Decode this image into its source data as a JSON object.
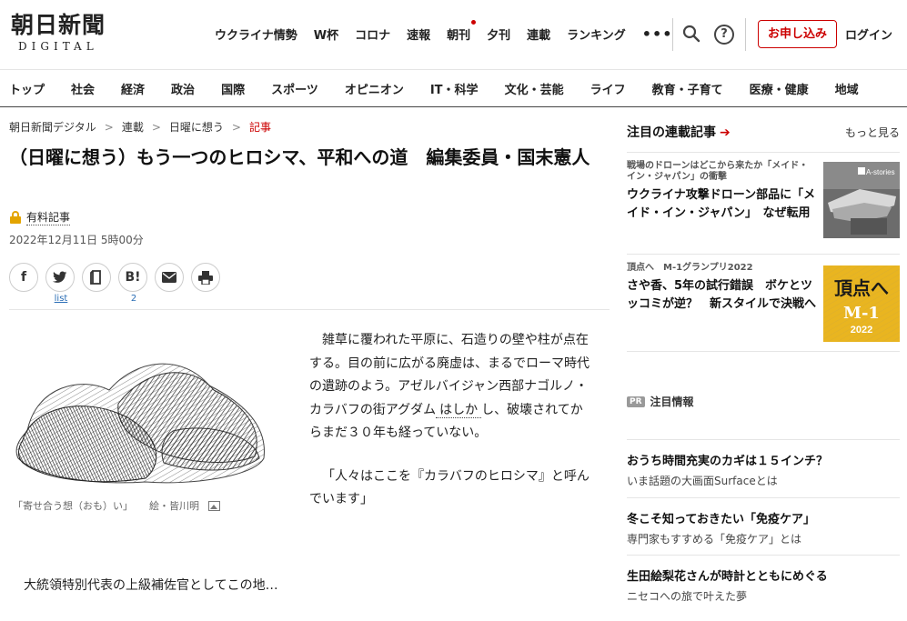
{
  "header": {
    "logo_main": "朝日新聞",
    "logo_sub": "DIGITAL",
    "nav": [
      "ウクライナ情勢",
      "W杯",
      "コロナ",
      "速報",
      "朝刊",
      "夕刊",
      "連載",
      "ランキング"
    ],
    "more": "•••",
    "apply_label": "お申し込み",
    "login_label": "ログイン"
  },
  "categories": [
    "トップ",
    "社会",
    "経済",
    "政治",
    "国際",
    "スポーツ",
    "オピニオン",
    "IT・科学",
    "文化・芸能",
    "ライフ",
    "教育・子育て",
    "医療・健康",
    "地域"
  ],
  "breadcrumb": {
    "home": "朝日新聞デジタル",
    "series": "連載",
    "column": "日曜に想う",
    "current": "記事"
  },
  "article": {
    "headline": "（日曜に想う）もう一つのヒロシマ、平和への道　編集委員・国末憲人",
    "paid_label": "有料記事",
    "date": "2022年12月11日 5時00分",
    "share": {
      "facebook": "f",
      "bookmark_count": "2",
      "list_label": "list",
      "hatena": "B!"
    },
    "caption": "「寄せ合う想（おも）い」",
    "credit": "絵・皆川明",
    "para1_a": "雑草に覆われた平原に、石造りの壁や柱が点在する。目の前に広がる廃虚は、まるでローマ時代の遺跡のよう。アゼルバイジャン西部ナゴルノ・カラバフの街アグダム",
    "para1_b": "し、破壊されてからまだ３０年も経っていない。",
    "para1_dotted": "はしか",
    "para2": "「人々はここを『カラバフのヒロシマ』と呼んでいます」",
    "teaser": "大統領特別代表の上級補佐官としてこの地…"
  },
  "sidebar": {
    "title": "注目の連載記事",
    "arrow": "➔",
    "more": "もっと見る",
    "cards": [
      {
        "kicker": "戦場のドローンはどこから来たか「メイド・イン・ジャパン」の衝撃",
        "text": "ウクライナ攻撃ドローン部品に「メイド・イン・ジャパン」　なぜ転用",
        "thumb_label": "A-stories"
      },
      {
        "kicker": "頂点へ　M-1グランプリ2022",
        "text": "さや香、5年の試行錯誤　ボケとツッコミが逆？　新スタイルで決戦へ",
        "thumb_label_1": "頂点へ",
        "thumb_label_2": "M-1",
        "thumb_label_3": "2022"
      }
    ]
  },
  "pr": {
    "badge": "PR",
    "title": "注目情報",
    "items": [
      {
        "title": "おうち時間充実のカギは１５インチ？",
        "sub": "いま話題の大画面Surfaceとは"
      },
      {
        "title": "冬こそ知っておきたい「免疫ケア」",
        "sub": "専門家もすすめる「免疫ケア」とは"
      },
      {
        "title": "生田絵梨花さんが時計とともにめぐる",
        "sub": "ニセコへの旅で叶えた夢"
      }
    ]
  }
}
